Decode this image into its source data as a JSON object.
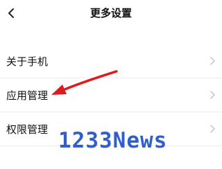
{
  "header": {
    "back_icon": "chevron-left-icon",
    "title": "更多设置"
  },
  "menu": {
    "items": [
      {
        "label": "关于手机",
        "icon": "chevron-right-icon"
      },
      {
        "label": "应用管理",
        "icon": "chevron-right-icon"
      },
      {
        "label": "权限管理",
        "icon": "chevron-right-icon"
      }
    ]
  },
  "annotation": {
    "icon": "red-arrow-icon",
    "color": "#e01b1b"
  },
  "watermark": {
    "text": "1233News",
    "color": "#2f5fc7"
  }
}
